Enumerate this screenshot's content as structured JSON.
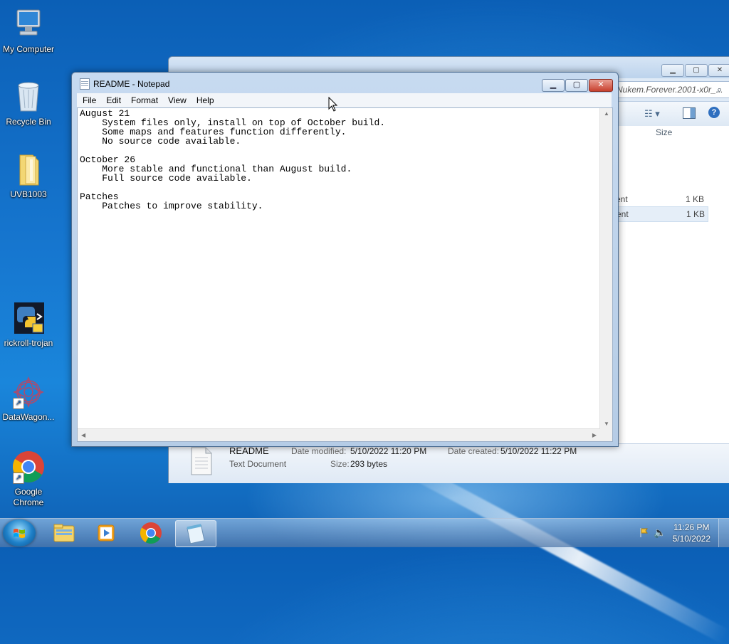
{
  "desktop": {
    "icons": [
      {
        "label": "My Computer",
        "icon": "computer-icon"
      },
      {
        "label": "Recycle Bin",
        "icon": "recycle-bin-icon"
      },
      {
        "label": "UVB1003",
        "icon": "folder-icon"
      },
      {
        "label": "rickroll-trojan",
        "icon": "python-shortcut-icon"
      },
      {
        "label": "DataWagon...",
        "icon": "datawagon-shortcut-icon"
      },
      {
        "label": "Google Chrome",
        "icon": "chrome-icon"
      }
    ]
  },
  "explorer": {
    "address_fragment": "Nukem.Forever.2001-x0r_...",
    "column_size": "Size",
    "rows": [
      {
        "type_fragment": "ent",
        "size": "1 KB"
      },
      {
        "type_fragment": "ent",
        "size": "1 KB"
      }
    ],
    "details": {
      "file_name": "README",
      "file_type": "Text Document",
      "modified_label": "Date modified:",
      "modified_value": "5/10/2022 11:20 PM",
      "created_label": "Date created:",
      "created_value": "5/10/2022 11:22 PM",
      "size_label": "Size:",
      "size_value": "293 bytes"
    }
  },
  "notepad": {
    "title": "README - Notepad",
    "menu": [
      "File",
      "Edit",
      "Format",
      "View",
      "Help"
    ],
    "content": "August 21\n    System files only, install on top of October build.\n    Some maps and features function differently.\n    No source code available.\n\nOctober 26\n    More stable and functional than August build.\n    Full source code available.\n\nPatches\n    Patches to improve stability."
  },
  "taskbar": {
    "apps": [
      "windows-explorer-icon",
      "media-player-icon",
      "chrome-icon",
      "notepad-icon"
    ],
    "time": "11:26 PM",
    "date": "5/10/2022"
  }
}
